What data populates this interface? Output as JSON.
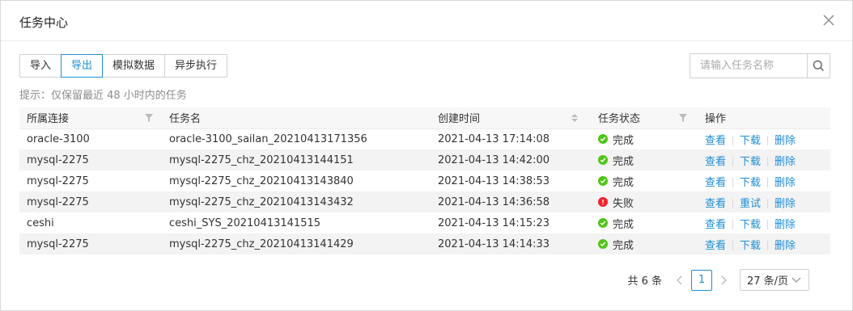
{
  "dialog": {
    "title": "任务中心",
    "close_icon": "close-icon"
  },
  "toolbar": {
    "buttons": [
      {
        "label": "导入",
        "active": false
      },
      {
        "label": "导出",
        "active": true
      },
      {
        "label": "模拟数据",
        "active": false
      },
      {
        "label": "异步执行",
        "active": false
      }
    ]
  },
  "search": {
    "placeholder": "请输入任务名称",
    "icon": "search-icon"
  },
  "hint": "提示：仅保留最近 48 小时内的任务",
  "table": {
    "columns": [
      "所属连接",
      "任务名",
      "创建时间",
      "任务状态",
      "操作"
    ],
    "rows": [
      {
        "connection": "oracle-3100",
        "task": "oracle-3100_sailan_20210413171356",
        "created": "2021-04-13 17:14:08",
        "status": "完成",
        "ok": true,
        "actions": [
          "查看",
          "下载",
          "删除"
        ]
      },
      {
        "connection": "mysql-2275",
        "task": "mysql-2275_chz_20210413144151",
        "created": "2021-04-13 14:42:00",
        "status": "完成",
        "ok": true,
        "actions": [
          "查看",
          "下载",
          "删除"
        ]
      },
      {
        "connection": "mysql-2275",
        "task": "mysql-2275_chz_20210413143840",
        "created": "2021-04-13 14:38:53",
        "status": "完成",
        "ok": true,
        "actions": [
          "查看",
          "下载",
          "删除"
        ]
      },
      {
        "connection": "mysql-2275",
        "task": "mysql-2275_chz_20210413143432",
        "created": "2021-04-13 14:36:58",
        "status": "失败",
        "ok": false,
        "actions": [
          "查看",
          "重试",
          "删除"
        ]
      },
      {
        "connection": "ceshi",
        "task": "ceshi_SYS_20210413141515",
        "created": "2021-04-13 14:15:23",
        "status": "完成",
        "ok": true,
        "actions": [
          "查看",
          "下载",
          "删除"
        ]
      },
      {
        "connection": "mysql-2275",
        "task": "mysql-2275_chz_20210413141429",
        "created": "2021-04-13 14:14:33",
        "status": "完成",
        "ok": true,
        "actions": [
          "查看",
          "下载",
          "删除"
        ]
      }
    ]
  },
  "pagination": {
    "total": "共 6 条",
    "current_page": "1",
    "page_size": "27 条/页"
  },
  "colors": {
    "accent": "#1f8ed6",
    "success": "#52c41a",
    "error": "#f5222d"
  }
}
